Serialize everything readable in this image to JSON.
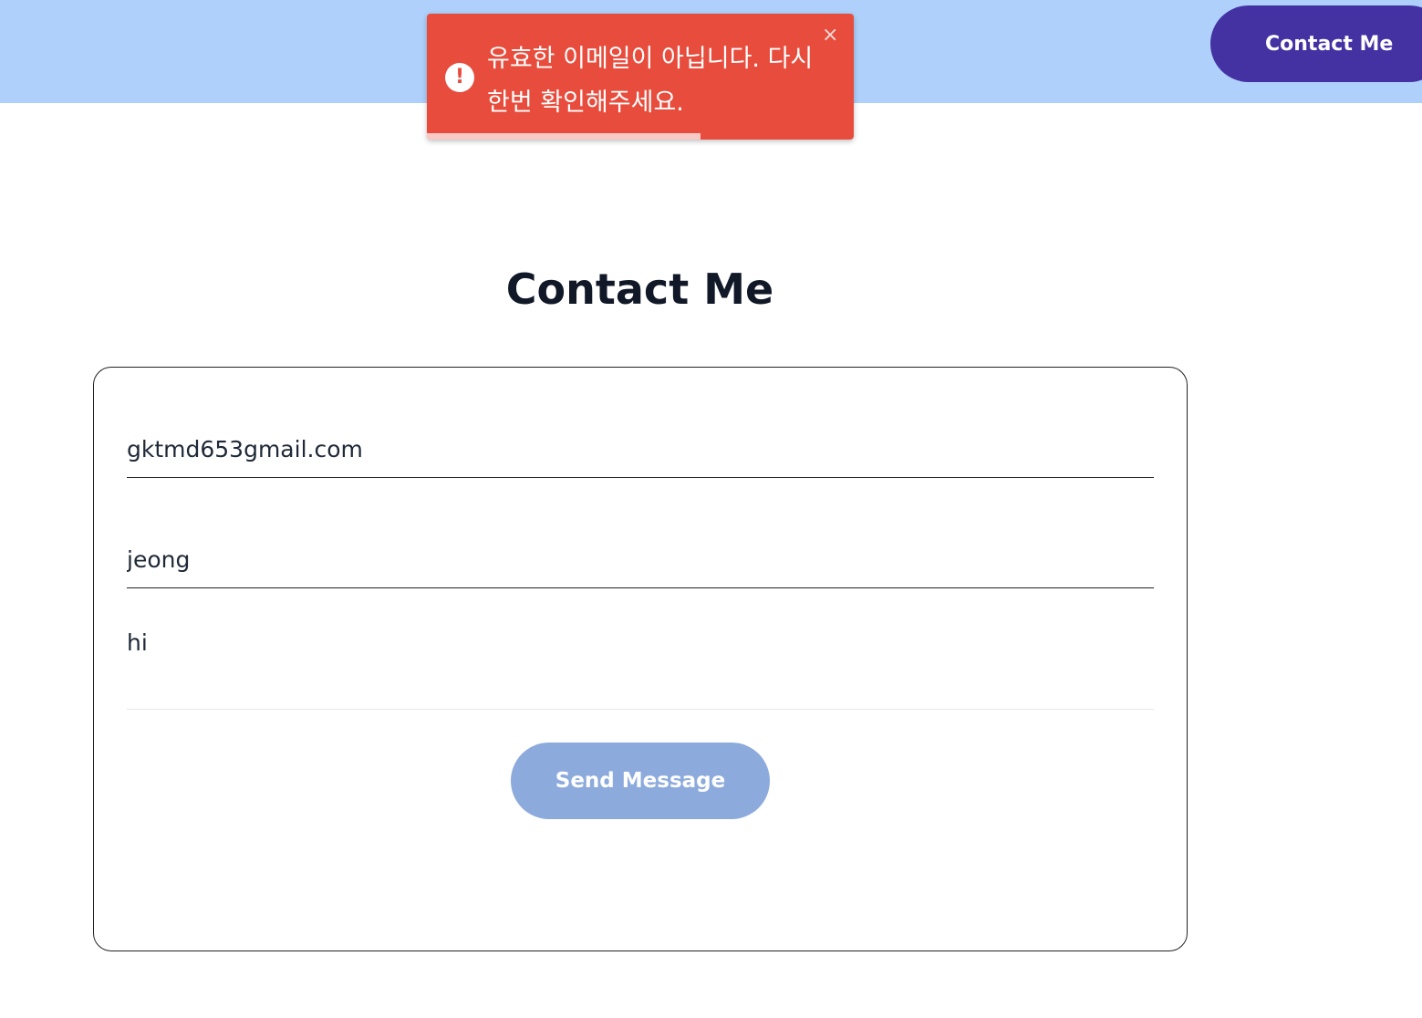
{
  "header": {
    "contact_button_label": "Contact Me"
  },
  "toast": {
    "type": "error",
    "icon": "exclamation-circle-icon",
    "message": "유효한 이메일이 아닙니다. 다시 한번 확인해주세요.",
    "close_label": "×",
    "progress_fraction": 0.64
  },
  "main": {
    "title": "Contact Me"
  },
  "form": {
    "email_value": "gktmd653gmail.com",
    "name_value": "jeong",
    "message_value": "hi",
    "submit_label": "Send Message"
  },
  "colors": {
    "header_bg": "#aed0fa",
    "nav_button_bg": "#4432a3",
    "toast_bg": "#e74c3c",
    "submit_bg": "#8daadd"
  }
}
